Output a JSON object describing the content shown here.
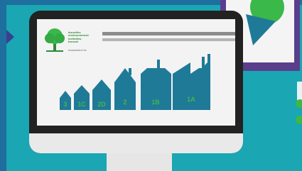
{
  "logo": {
    "line1": "bruxelles",
    "line2": "environnement",
    "line3": "leefmilieu",
    "line4": "brussel",
    "subtitle": "brusselsefa.nl.be"
  },
  "classes": [
    "3",
    "1C",
    "2D",
    "2",
    "1B",
    "1A"
  ],
  "colors": {
    "background": "#1aa6b3",
    "building": "#1f7a98",
    "label": "#46b34e",
    "monitor": "#222222"
  }
}
